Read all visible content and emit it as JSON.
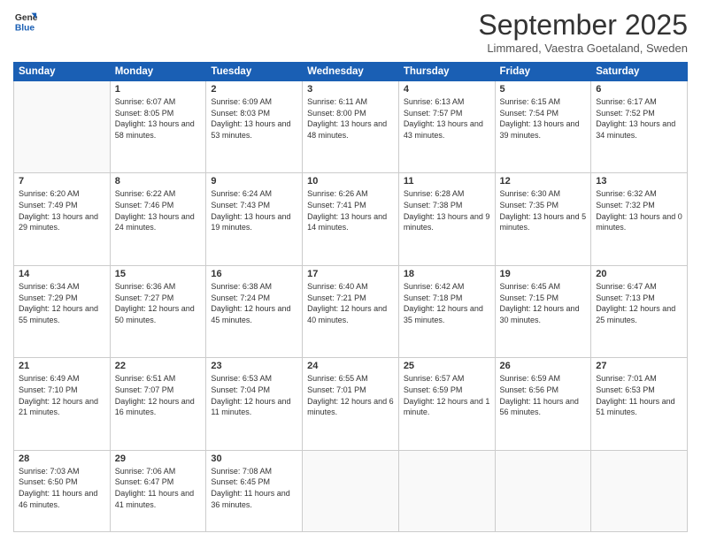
{
  "header": {
    "logo_general": "General",
    "logo_blue": "Blue",
    "month_title": "September 2025",
    "location": "Limmared, Vaestra Goetaland, Sweden"
  },
  "days_of_week": [
    "Sunday",
    "Monday",
    "Tuesday",
    "Wednesday",
    "Thursday",
    "Friday",
    "Saturday"
  ],
  "weeks": [
    [
      {
        "day": "",
        "info": ""
      },
      {
        "day": "1",
        "info": "Sunrise: 6:07 AM\nSunset: 8:05 PM\nDaylight: 13 hours\nand 58 minutes."
      },
      {
        "day": "2",
        "info": "Sunrise: 6:09 AM\nSunset: 8:03 PM\nDaylight: 13 hours\nand 53 minutes."
      },
      {
        "day": "3",
        "info": "Sunrise: 6:11 AM\nSunset: 8:00 PM\nDaylight: 13 hours\nand 48 minutes."
      },
      {
        "day": "4",
        "info": "Sunrise: 6:13 AM\nSunset: 7:57 PM\nDaylight: 13 hours\nand 43 minutes."
      },
      {
        "day": "5",
        "info": "Sunrise: 6:15 AM\nSunset: 7:54 PM\nDaylight: 13 hours\nand 39 minutes."
      },
      {
        "day": "6",
        "info": "Sunrise: 6:17 AM\nSunset: 7:52 PM\nDaylight: 13 hours\nand 34 minutes."
      }
    ],
    [
      {
        "day": "7",
        "info": "Sunrise: 6:20 AM\nSunset: 7:49 PM\nDaylight: 13 hours\nand 29 minutes."
      },
      {
        "day": "8",
        "info": "Sunrise: 6:22 AM\nSunset: 7:46 PM\nDaylight: 13 hours\nand 24 minutes."
      },
      {
        "day": "9",
        "info": "Sunrise: 6:24 AM\nSunset: 7:43 PM\nDaylight: 13 hours\nand 19 minutes."
      },
      {
        "day": "10",
        "info": "Sunrise: 6:26 AM\nSunset: 7:41 PM\nDaylight: 13 hours\nand 14 minutes."
      },
      {
        "day": "11",
        "info": "Sunrise: 6:28 AM\nSunset: 7:38 PM\nDaylight: 13 hours\nand 9 minutes."
      },
      {
        "day": "12",
        "info": "Sunrise: 6:30 AM\nSunset: 7:35 PM\nDaylight: 13 hours\nand 5 minutes."
      },
      {
        "day": "13",
        "info": "Sunrise: 6:32 AM\nSunset: 7:32 PM\nDaylight: 13 hours\nand 0 minutes."
      }
    ],
    [
      {
        "day": "14",
        "info": "Sunrise: 6:34 AM\nSunset: 7:29 PM\nDaylight: 12 hours\nand 55 minutes."
      },
      {
        "day": "15",
        "info": "Sunrise: 6:36 AM\nSunset: 7:27 PM\nDaylight: 12 hours\nand 50 minutes."
      },
      {
        "day": "16",
        "info": "Sunrise: 6:38 AM\nSunset: 7:24 PM\nDaylight: 12 hours\nand 45 minutes."
      },
      {
        "day": "17",
        "info": "Sunrise: 6:40 AM\nSunset: 7:21 PM\nDaylight: 12 hours\nand 40 minutes."
      },
      {
        "day": "18",
        "info": "Sunrise: 6:42 AM\nSunset: 7:18 PM\nDaylight: 12 hours\nand 35 minutes."
      },
      {
        "day": "19",
        "info": "Sunrise: 6:45 AM\nSunset: 7:15 PM\nDaylight: 12 hours\nand 30 minutes."
      },
      {
        "day": "20",
        "info": "Sunrise: 6:47 AM\nSunset: 7:13 PM\nDaylight: 12 hours\nand 25 minutes."
      }
    ],
    [
      {
        "day": "21",
        "info": "Sunrise: 6:49 AM\nSunset: 7:10 PM\nDaylight: 12 hours\nand 21 minutes."
      },
      {
        "day": "22",
        "info": "Sunrise: 6:51 AM\nSunset: 7:07 PM\nDaylight: 12 hours\nand 16 minutes."
      },
      {
        "day": "23",
        "info": "Sunrise: 6:53 AM\nSunset: 7:04 PM\nDaylight: 12 hours\nand 11 minutes."
      },
      {
        "day": "24",
        "info": "Sunrise: 6:55 AM\nSunset: 7:01 PM\nDaylight: 12 hours\nand 6 minutes."
      },
      {
        "day": "25",
        "info": "Sunrise: 6:57 AM\nSunset: 6:59 PM\nDaylight: 12 hours\nand 1 minute."
      },
      {
        "day": "26",
        "info": "Sunrise: 6:59 AM\nSunset: 6:56 PM\nDaylight: 11 hours\nand 56 minutes."
      },
      {
        "day": "27",
        "info": "Sunrise: 7:01 AM\nSunset: 6:53 PM\nDaylight: 11 hours\nand 51 minutes."
      }
    ],
    [
      {
        "day": "28",
        "info": "Sunrise: 7:03 AM\nSunset: 6:50 PM\nDaylight: 11 hours\nand 46 minutes."
      },
      {
        "day": "29",
        "info": "Sunrise: 7:06 AM\nSunset: 6:47 PM\nDaylight: 11 hours\nand 41 minutes."
      },
      {
        "day": "30",
        "info": "Sunrise: 7:08 AM\nSunset: 6:45 PM\nDaylight: 11 hours\nand 36 minutes."
      },
      {
        "day": "",
        "info": ""
      },
      {
        "day": "",
        "info": ""
      },
      {
        "day": "",
        "info": ""
      },
      {
        "day": "",
        "info": ""
      }
    ]
  ]
}
